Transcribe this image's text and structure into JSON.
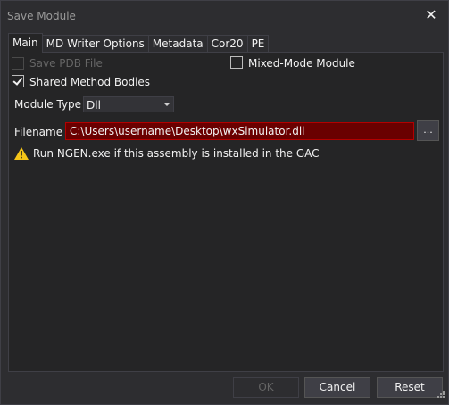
{
  "window": {
    "title": "Save Module",
    "close_icon": "close-icon"
  },
  "tabs": [
    {
      "label": "Main",
      "active": true
    },
    {
      "label": "MD Writer Options",
      "active": false
    },
    {
      "label": "Metadata",
      "active": false
    },
    {
      "label": "Cor20",
      "active": false
    },
    {
      "label": "PE",
      "active": false
    }
  ],
  "main": {
    "save_pdb": {
      "label": "Save PDB File",
      "checked": false,
      "enabled": false
    },
    "mixed_mode": {
      "label": "Mixed-Mode Module",
      "checked": false,
      "enabled": true
    },
    "shared_method_bodies": {
      "label": "Shared Method Bodies",
      "checked": true,
      "enabled": true
    },
    "module_type": {
      "label": "Module Type",
      "value": "Dll"
    },
    "filename": {
      "label": "Filename",
      "value": "C:\\Users\\username\\Desktop\\wxSimulator.dll",
      "browse_label": "..."
    },
    "warning": {
      "icon": "warning-icon",
      "text": "Run NGEN.exe if this assembly is installed in the GAC"
    }
  },
  "buttons": {
    "ok": "OK",
    "cancel": "Cancel",
    "reset": "Reset"
  },
  "colors": {
    "filename_error_bg": "#6a0000",
    "filename_error_border": "#b30000",
    "warning_icon": "#f5c518"
  }
}
